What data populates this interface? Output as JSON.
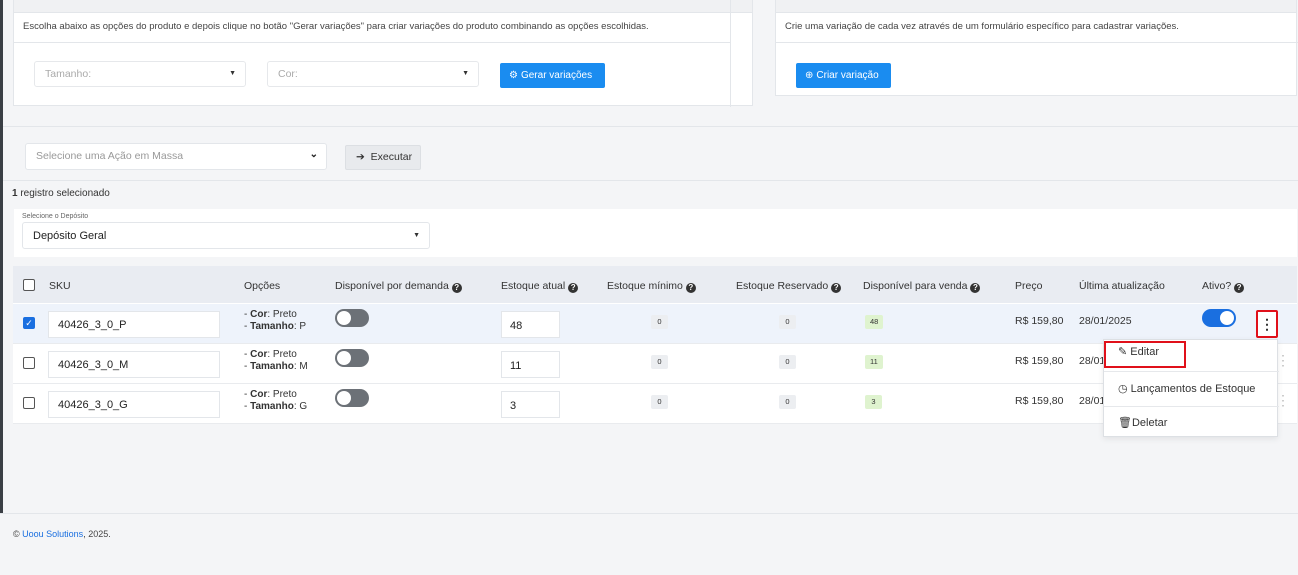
{
  "generate_panel": {
    "description": "Escolha abaixo as opções do produto e depois clique no botão \"Gerar variações\" para criar variações do produto combinando as opções escolhidas.",
    "tamanho_placeholder": "Tamanho:",
    "cor_placeholder": "Cor:",
    "generate_button": "Gerar variações"
  },
  "create_panel": {
    "description": "Crie uma variação de cada vez através de um formulário específico para cadastrar variações.",
    "create_button": "Criar variação"
  },
  "mass_action": {
    "placeholder": "Selecione uma Ação em Massa",
    "execute_button": "Executar"
  },
  "selection": {
    "count": "1",
    "label": " registro selecionado"
  },
  "deposit": {
    "label": "Selecione o Depósito",
    "value": "Depósito Geral"
  },
  "table": {
    "headers": {
      "sku": "SKU",
      "options": "Opções",
      "on_demand": "Disponível por demanda",
      "stock": "Estoque atual",
      "min_stock": "Estoque mínimo",
      "reserved": "Estoque Reservado",
      "available": "Disponível para venda",
      "price": "Preço",
      "updated": "Última atualização",
      "active": "Ativo?"
    },
    "rows": [
      {
        "sku": "40426_3_0_P",
        "cor_label": "Cor",
        "cor": "Preto",
        "tamanho_label": "Tamanho",
        "tamanho": "P",
        "stock": "48",
        "min": "0",
        "reserved": "0",
        "available": "48",
        "price": "R$ 159,80",
        "date": "28/01/2025",
        "selected": true,
        "active": true
      },
      {
        "sku": "40426_3_0_M",
        "cor_label": "Cor",
        "cor": "Preto",
        "tamanho_label": "Tamanho",
        "tamanho": "M",
        "stock": "11",
        "min": "0",
        "reserved": "0",
        "available": "11",
        "price": "R$ 159,80",
        "date": "28/01",
        "selected": false,
        "active": false
      },
      {
        "sku": "40426_3_0_G",
        "cor_label": "Cor",
        "cor": "Preto",
        "tamanho_label": "Tamanho",
        "tamanho": "G",
        "stock": "3",
        "min": "0",
        "reserved": "0",
        "available": "3",
        "price": "R$ 159,80",
        "date": "28/01",
        "selected": false,
        "active": false
      }
    ]
  },
  "row_menu": {
    "edit": "Editar",
    "stock_entries": "Lançamentos de Estoque",
    "delete": "Deletar"
  },
  "footer": {
    "prefix": "© ",
    "brand": "Uoou Solutions",
    "suffix": ", 2025."
  },
  "icons": {
    "gear": "gears-icon",
    "plus": "plus-circle-icon",
    "arrow": "arrow-right-icon",
    "pencil": "pencil-icon",
    "clock": "clock-icon",
    "trash": "trash-icon",
    "help": "question-circle-icon"
  },
  "colors": {
    "primary": "#1a8cf0",
    "highlight": "#e0101a",
    "toggle_on": "#1a6fe0",
    "badge_green": "#dff3cf"
  }
}
